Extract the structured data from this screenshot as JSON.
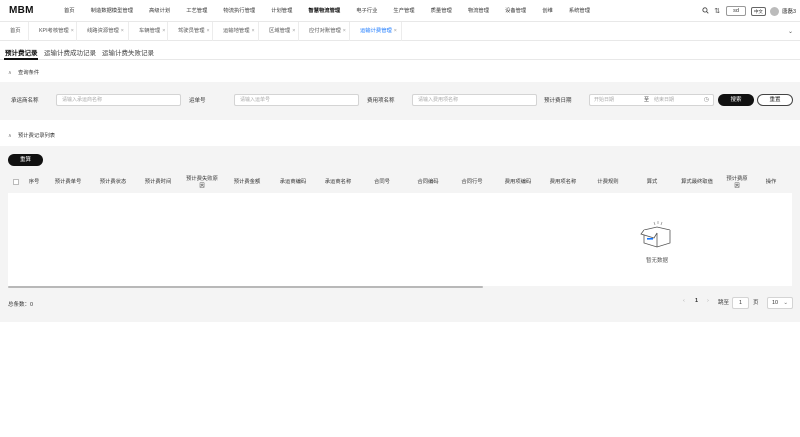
{
  "app": {
    "logo": "MBM"
  },
  "menu": [
    "首页",
    "制造数据模型管理",
    "高级计划",
    "工艺管理",
    "物流执行管理",
    "计划管理",
    "智慧物流管理",
    "电子行业",
    "生产管理",
    "质量管理",
    "物流管理",
    "设备管理",
    "创维",
    "系统管理"
  ],
  "header": {
    "sd_label": "sd",
    "lang_label": "中文",
    "user_name": "唐磊3"
  },
  "tabs": [
    "首页",
    "KPI考核管理",
    "线路资源管理",
    "车辆管理",
    "驾驶员管理",
    "运输地管理",
    "区域管理",
    "应付对账管理",
    "运输计费管理"
  ],
  "subtabs": [
    "预计费记录",
    "运输计费成功记录",
    "运输计费失败记录"
  ],
  "query": {
    "section_title": "查询条件",
    "carrier_label": "承运商名称",
    "carrier_placeholder": "请输入承运商名称",
    "waybill_label": "运单号",
    "waybill_placeholder": "请输入运单号",
    "fee_label": "费用项名称",
    "fee_placeholder": "请输入费用项名称",
    "date_label": "预计费日期",
    "date_start": "开始日期",
    "date_to": "至",
    "date_end": "结束日期",
    "search_button": "搜索",
    "reset_button": "重置"
  },
  "list": {
    "section_title": "预计费记录列表",
    "recalc_button": "重算",
    "columns": [
      "序号",
      "预计费单号",
      "预计费状态",
      "预计费时间",
      "预计费失败原因",
      "预计费金额",
      "承运商编码",
      "承运商名称",
      "合同号",
      "合同编码",
      "合同行号",
      "费用项编码",
      "费用项名称",
      "计费规则",
      "算式",
      "算式最终取值",
      "预计费原因",
      "操作"
    ],
    "empty_text": "暂无数据"
  },
  "pagination": {
    "total_label": "总条数：",
    "total": "0",
    "page": "1",
    "jump_label": "跳至",
    "jump_value": "1",
    "page_unit": "页",
    "page_size": "10"
  }
}
